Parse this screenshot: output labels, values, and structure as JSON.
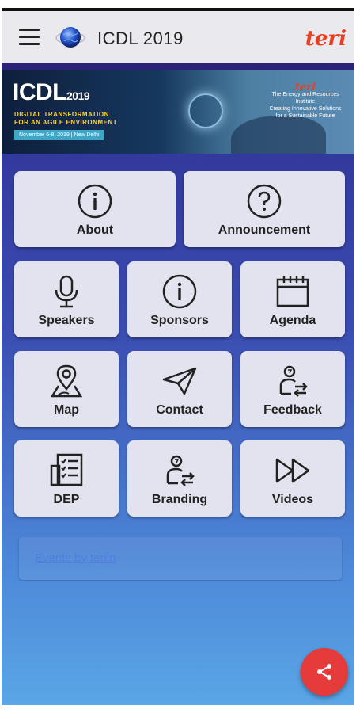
{
  "appbar": {
    "title": "ICDL 2019",
    "brand_logo_text": "teri",
    "menu_icon": "hamburger-menu-icon",
    "globe_icon": "globe-icon"
  },
  "banner": {
    "title": "ICDL",
    "title_year": "2019",
    "subtitle_line1": "DIGITAL TRANSFORMATION",
    "subtitle_line2": "FOR AN AGILE ENVIRONMENT",
    "date_text": "November 6-8, 2019 | New Delhi",
    "org_logo": "teri",
    "org_name_line1": "The Energy and Resources Institute",
    "org_name_line2": "Creating Innovative Solutions for a Sustainable Future"
  },
  "tiles": [
    {
      "label": "About",
      "icon": "info-icon"
    },
    {
      "label": "Announcement",
      "icon": "question-icon"
    },
    {
      "label": "Speakers",
      "icon": "microphone-icon"
    },
    {
      "label": "Sponsors",
      "icon": "info-icon"
    },
    {
      "label": "Agenda",
      "icon": "calendar-icon"
    },
    {
      "label": "Map",
      "icon": "map-pin-icon"
    },
    {
      "label": "Contact",
      "icon": "paper-plane-icon"
    },
    {
      "label": "Feedback",
      "icon": "person-exchange-icon"
    },
    {
      "label": "DEP",
      "icon": "checklist-icon"
    },
    {
      "label": "Branding",
      "icon": "person-exchange-icon"
    },
    {
      "label": "Videos",
      "icon": "fast-forward-icon"
    }
  ],
  "events_link": "Events by teriin",
  "fab_icon": "share-icon",
  "colors": {
    "appbar_bg": "#e9e9ee",
    "accent_dark": "#2b2378",
    "brand_orange": "#e8401f",
    "tile_bg": "#e2e3ee",
    "fab_red": "#e53b3b",
    "link_blue": "#4f78e3"
  }
}
